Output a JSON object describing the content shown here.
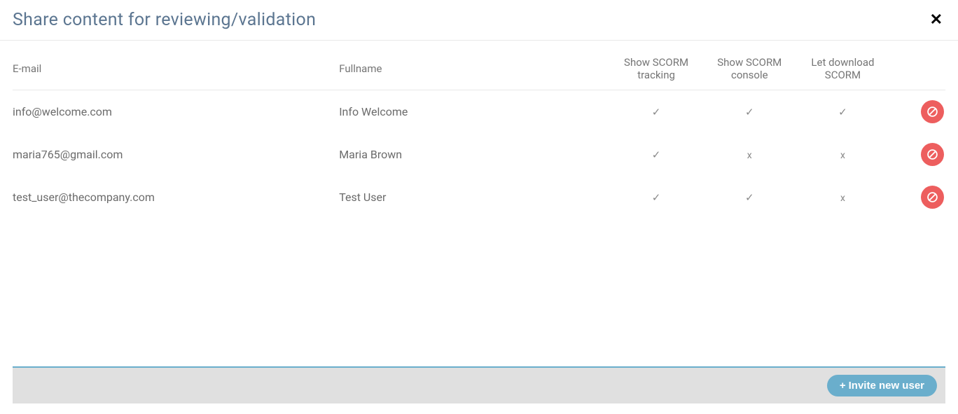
{
  "header": {
    "title": "Share content for reviewing/validation"
  },
  "columns": {
    "email": "E-mail",
    "fullname": "Fullname",
    "show_tracking": "Show SCORM tracking",
    "show_console": "Show SCORM console",
    "let_download": "Let download SCORM"
  },
  "marks": {
    "check": "✓",
    "x": "x"
  },
  "rows": [
    {
      "email": "info@welcome.com",
      "fullname": "Info Welcome",
      "tracking": "✓",
      "console": "✓",
      "download": "✓"
    },
    {
      "email": "maria765@gmail.com",
      "fullname": "Maria Brown",
      "tracking": "✓",
      "console": "x",
      "download": "x"
    },
    {
      "email": "test_user@thecompany.com",
      "fullname": "Test User",
      "tracking": "✓",
      "console": "✓",
      "download": "x"
    }
  ],
  "footer": {
    "invite_label": "Invite new user"
  }
}
